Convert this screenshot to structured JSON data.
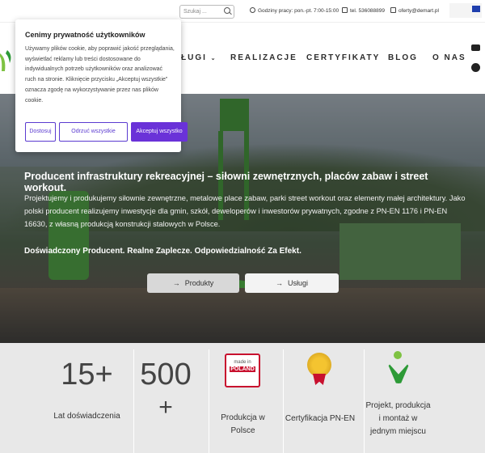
{
  "topbar": {
    "search_placeholder": "Szukaj ...",
    "hours": "Godziny pracy: pon.-pt. 7:00-15:00",
    "phone": "tel. 536088899",
    "email": "oferty@demart.pl",
    "eu_text": "Rzeczpospolita Polska / Unia Europejska"
  },
  "nav": {
    "items": [
      "ŁUGI",
      "REALIZACJE",
      "CERTYFIKATY",
      "BLOG",
      "O NAS"
    ]
  },
  "social": [
    "youtube-icon",
    "facebook-icon"
  ],
  "hero": {
    "title": "Producent infrastruktury rekreacyjnej – siłowni zewnętrznych, placów zabaw i street workout.",
    "text": "Projektujemy i produkujemy siłownie zewnętrzne, metalowe place zabaw, parki street workout oraz elementy małej architektury. Jako polski producent realizujemy inwestycje dla gmin, szkół, deweloperów i inwestorów prywatnych, zgodne z PN-EN 1176 i PN-EN 16630, z własną produkcją konstrukcji stalowych w Polsce.",
    "strong": "Doświadczony Producent. Realne Zaplecze. Odpowiedzialność Za Efekt.",
    "button_products": "Produkty",
    "button_services": "Usługi"
  },
  "stats": [
    {
      "num": "15+",
      "label": "Lat doświadczenia"
    },
    {
      "num": "500",
      "num2": "+",
      "label": ""
    },
    {
      "label1": "Produkcja w",
      "label2": "Polsce",
      "badge_top": "made in",
      "badge_main": "POLAND"
    },
    {
      "label": "Certyfikacja PN-EN"
    },
    {
      "label1": "Projekt, produkcja",
      "label2": "i montaż w",
      "label3": "jednym miejscu"
    }
  ],
  "cookie": {
    "title": "Cenimy prywatność użytkowników",
    "body": "Używamy plików cookie, aby poprawić jakość przeglądania, wyświetlać reklamy lub treści dostosowane do indywidualnych potrzeb użytkowników oraz analizować ruch na stronie. Kliknięcie przycisku „Akceptuj wszystkie” oznacza zgodę na wykorzystywanie przez nas plików cookie.",
    "btn_customize": "Dostosuj",
    "btn_reject": "Odrzuć wszystkie",
    "btn_accept": "Akceptuj wszystko"
  },
  "colors": {
    "accent": "#6a32d8",
    "green": "#3f8f32",
    "red": "#c8102e"
  }
}
